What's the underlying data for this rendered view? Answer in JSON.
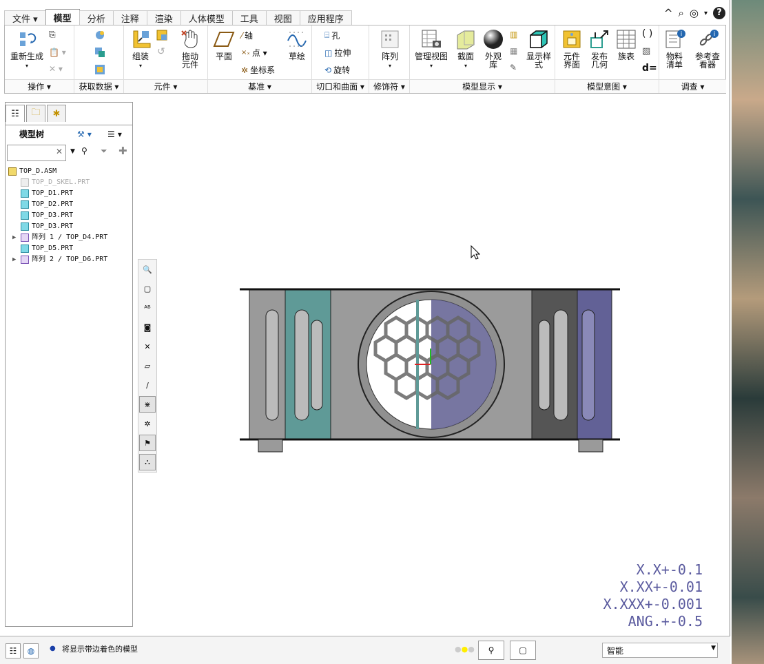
{
  "tabs": [
    "文件 ▾",
    "模型",
    "分析",
    "注释",
    "渲染",
    "人体模型",
    "工具",
    "视图",
    "应用程序"
  ],
  "top_icons": [
    "^",
    "🔍",
    "◉",
    "▾",
    "?"
  ],
  "ribbon": {
    "groups": {
      "ops": "操作 ▾",
      "getdata": "获取数据 ▾",
      "comp": "元件 ▾",
      "datum": "基准 ▾",
      "cut": "切口和曲面 ▾",
      "deco": "修饰符 ▾",
      "display": "模型显示 ▾",
      "intent": "模型意图 ▾",
      "inv": "调查 ▾"
    },
    "buttons": {
      "regen": "重新生成",
      "assemble": "组装",
      "drag1": "拖动",
      "drag2": "元件",
      "plane": "平面",
      "axis": "轴",
      "point": "点 ▾",
      "csys": "坐标系",
      "sketch": "草绘",
      "hole": "孔",
      "extrude": "拉伸",
      "revolve": "旋转",
      "pattern": "阵列",
      "manage": "管理视图",
      "section": "截面",
      "appearance1": "外观",
      "appearance2": "库",
      "dispstyle1": "显示样",
      "dispstyle2": "式",
      "compif1": "元件",
      "compif2": "界面",
      "pubgeom1": "发布",
      "pubgeom2": "几何",
      "famtab": "族表",
      "bom1": "物料",
      "bom2": "清单",
      "ref1": "参考查",
      "ref2": "看器"
    }
  },
  "left_pane": {
    "title": "模型树",
    "search_clear": "✕",
    "tree": [
      {
        "label": "TOP_D.ASM",
        "type": "asm",
        "indent": 0,
        "expand": ""
      },
      {
        "label": "TOP_D_SKEL.PRT",
        "type": "skel",
        "indent": 1,
        "expand": ""
      },
      {
        "label": "TOP_D1.PRT",
        "type": "prt",
        "indent": 1,
        "expand": ""
      },
      {
        "label": "TOP_D2.PRT",
        "type": "prt",
        "indent": 1,
        "expand": ""
      },
      {
        "label": "TOP_D3.PRT",
        "type": "prt",
        "indent": 1,
        "expand": ""
      },
      {
        "label": "TOP_D3.PRT",
        "type": "prt",
        "indent": 1,
        "expand": ""
      },
      {
        "label": "阵列 1 / TOP_D4.PRT",
        "type": "pat",
        "indent": 1,
        "expand": "▶"
      },
      {
        "label": "TOP_D5.PRT",
        "type": "prt",
        "indent": 1,
        "expand": ""
      },
      {
        "label": "阵列 2 / TOP_D6.PRT",
        "type": "pat",
        "indent": 1,
        "expand": "▶"
      }
    ]
  },
  "tolerance": [
    "X.X+-0.1",
    "X.XX+-0.01",
    "X.XXX+-0.001",
    "ANG.+-0.5"
  ],
  "status": {
    "message": "将显示带边着色的模型",
    "filter": "智能"
  },
  "colors": {
    "teal": "#5f9a97",
    "purple": "#626196",
    "dark": "#555555"
  }
}
